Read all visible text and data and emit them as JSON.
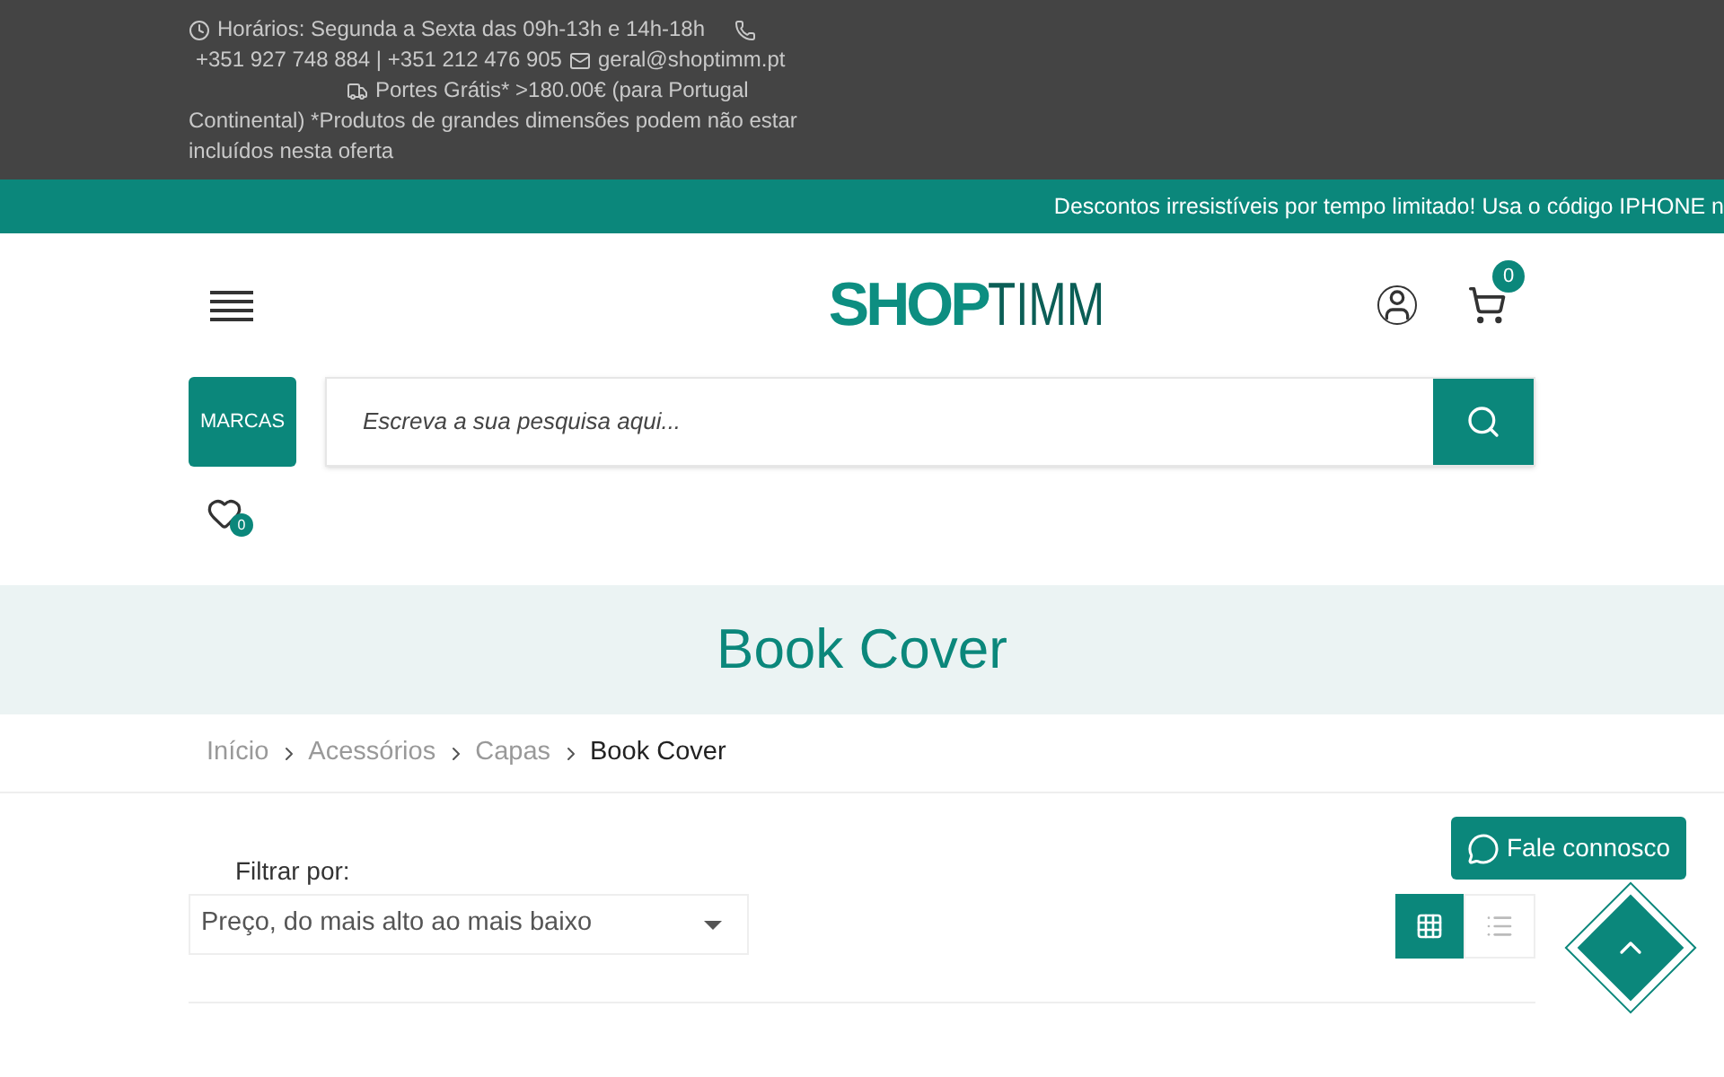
{
  "top_bar": {
    "hours": "Horários: Segunda a Sexta das 09h-13h e 14h-18h",
    "phones": "+351 927 748 884 | +351 212 476 905",
    "email": "geral@shoptimm.pt",
    "shipping": [
      "Portes Grátis* >180.00€ (para Portugal",
      "Continental) *Produtos de grandes dimensões podem não estar incluídos nesta oferta"
    ]
  },
  "announcement": "Descontos irresistíveis por tempo limitado! Usa o código IPHONE n",
  "header": {
    "logo": [
      "SHOP",
      "TIMM"
    ],
    "cart_count": "0",
    "brands_button": "MARCAS",
    "search": {
      "placeholder": "Escreva a sua pesquisa aqui..."
    },
    "wishlist_count": "0"
  },
  "page_title": "Book Cover",
  "breadcrumbs": [
    {
      "label": "Início",
      "current": false
    },
    {
      "label": "Acessórios",
      "current": false
    },
    {
      "label": "Capas",
      "current": false
    },
    {
      "label": "Book Cover",
      "current": true
    }
  ],
  "filter": {
    "label": "Filtrar por:",
    "value": "Preço, do mais alto ao mais baixo"
  },
  "views": [
    {
      "kind": "grid",
      "selected": true
    },
    {
      "kind": "list",
      "selected": false
    }
  ],
  "contact_button": "Fale connosco"
}
